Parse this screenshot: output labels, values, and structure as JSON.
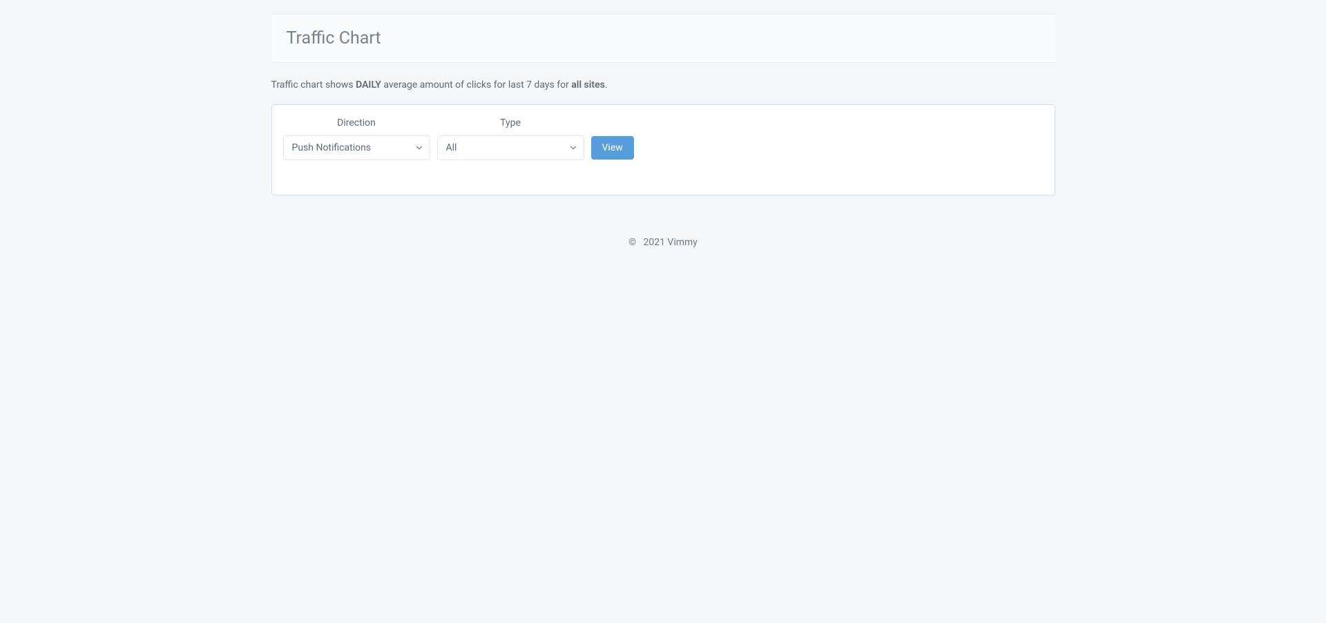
{
  "header": {
    "title": "Traffic Chart"
  },
  "description": {
    "prefix": "Traffic chart shows ",
    "emphasis1": "DAILY",
    "middle": " average amount of clicks for last 7 days for ",
    "emphasis2": "all sites",
    "suffix": "."
  },
  "form": {
    "direction": {
      "label": "Direction",
      "selected": "Push Notifications"
    },
    "type": {
      "label": "Type",
      "selected": "All"
    },
    "viewButton": "View"
  },
  "footer": {
    "copyright": "©",
    "text": "2021 Vimmy"
  }
}
